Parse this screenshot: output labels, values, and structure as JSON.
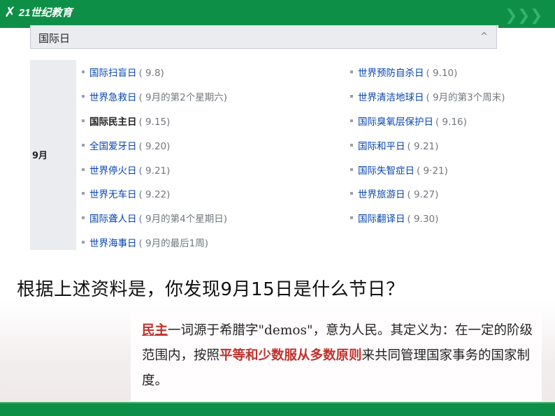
{
  "header": {
    "logo_text": "21世纪教育",
    "logo_icon": "runner-icon"
  },
  "panel": {
    "title": "国际日",
    "collapse_symbol": "^",
    "row_header": "9月",
    "left": [
      {
        "name": "国际扫盲日",
        "date": "( 9.8)"
      },
      {
        "name": "世界急救日",
        "date": "( 9月的第2个星期六)"
      },
      {
        "name": "国际民主日",
        "date": "( 9.15)",
        "bold": true
      },
      {
        "name": "全国爱牙日",
        "date": "( 9.20)"
      },
      {
        "name": "世界停火日",
        "date": "( 9.21)"
      },
      {
        "name": "世界无车日",
        "date": "( 9.22)"
      },
      {
        "name": "国际聋人日",
        "date": "( 9月的第4个星期日)"
      },
      {
        "name": "世界海事日",
        "date": "( 9月的最后1周)"
      }
    ],
    "right": [
      {
        "name": "世界预防自杀日",
        "date": "( 9.10)"
      },
      {
        "name": "世界清洁地球日",
        "date": "( 9月的第3个周末)"
      },
      {
        "name": "国际臭氧层保护日",
        "date": "( 9.16)"
      },
      {
        "name": "国际和平日",
        "date": "( 9.21)"
      },
      {
        "name": "国际失智症日",
        "date": "( 9·21)"
      },
      {
        "name": "世界旅游日",
        "date": "( 9.27)"
      },
      {
        "name": "国际翻译日",
        "date": "( 9.30)"
      }
    ]
  },
  "question": "根据上述资料是，你发现9月15日是什么节日？",
  "definition": {
    "term": "民主",
    "part1": "一词源于希腊字\"demos\"，意为人民。其定义为：在一定的阶级范围内，按照",
    "highlight": "平等和少数服从多数原则",
    "part2": "来共同管理国家事务的国家制度。"
  },
  "colors": {
    "green": "#0e8f47",
    "link": "#0645ad",
    "red": "#c0312c"
  }
}
